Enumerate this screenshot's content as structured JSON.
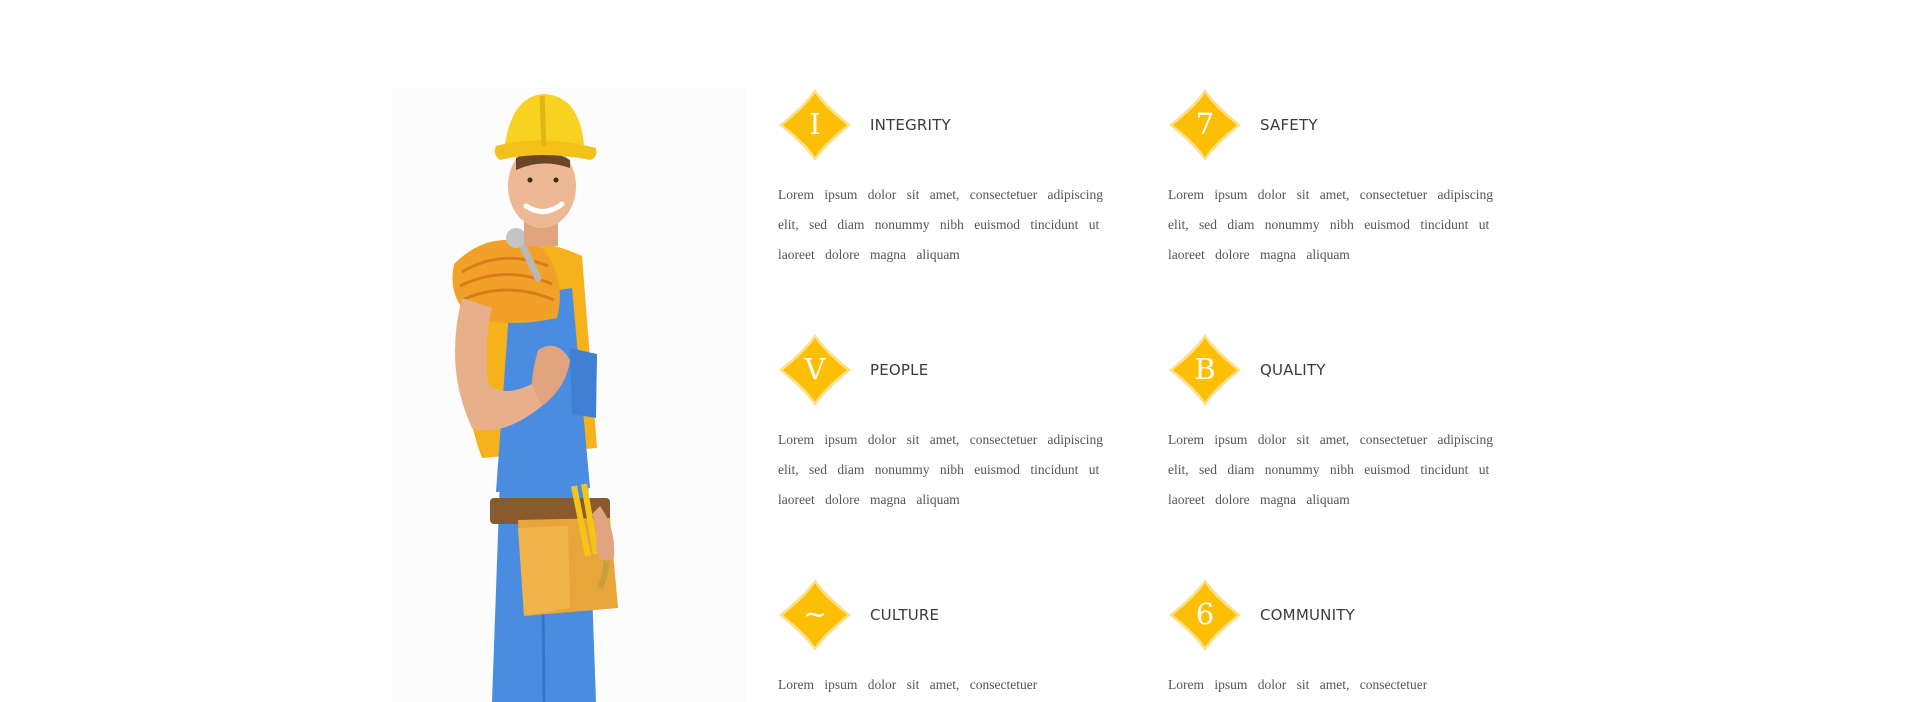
{
  "photo": {
    "description_icon": "construction-worker-illustration"
  },
  "colors": {
    "accent": "#fcbf05",
    "accent_light": "#fde08a",
    "heading": "#3b3b3b",
    "body_text": "#555555"
  },
  "values": [
    {
      "glyph": "I",
      "title": "INTEGRITY",
      "body": "Lorem ipsum dolor sit amet, consectetuer adipiscing elit, sed diam nonummy nibh euismod tincidunt ut laoreet dolore magna aliquam"
    },
    {
      "glyph": "7",
      "title": "SAFETY",
      "body": "Lorem ipsum dolor sit amet, consectetuer adipiscing elit, sed diam nonummy nibh euismod tincidunt ut laoreet dolore magna aliquam"
    },
    {
      "glyph": "V",
      "title": "PEOPLE",
      "body": "Lorem ipsum dolor sit amet, consectetuer adipiscing elit, sed diam nonummy nibh euismod tincidunt ut laoreet dolore magna aliquam"
    },
    {
      "glyph": "B",
      "title": "QUALITY",
      "body": "Lorem ipsum dolor sit amet, consectetuer adipiscing elit, sed diam nonummy nibh euismod tincidunt ut laoreet dolore magna aliquam"
    },
    {
      "glyph": "~",
      "title": "CULTURE",
      "body": "Lorem ipsum dolor sit amet, consectetuer"
    },
    {
      "glyph": "6",
      "title": "COMMUNITY",
      "body": "Lorem ipsum dolor sit amet, consectetuer"
    }
  ]
}
